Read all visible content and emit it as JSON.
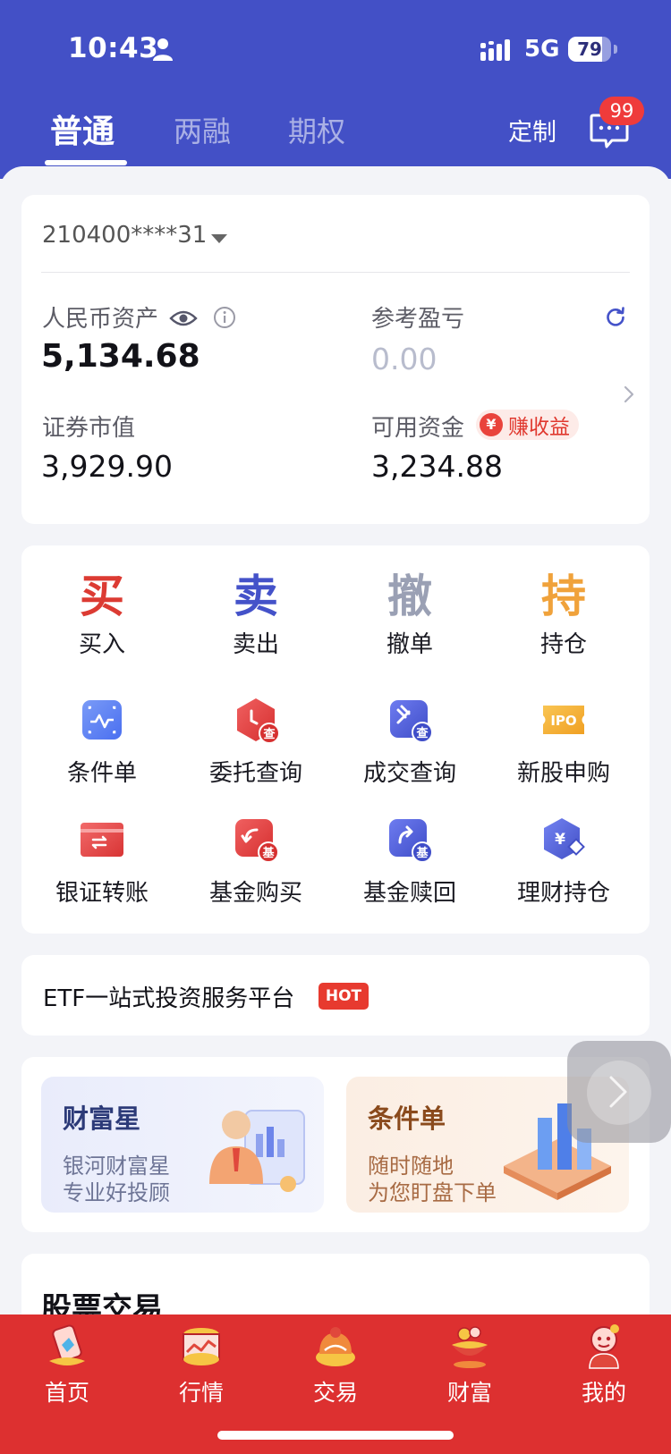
{
  "status_bar": {
    "time": "10:43",
    "network": "5G",
    "battery": "79",
    "battery_level": 0.79
  },
  "tabs": [
    {
      "label": "普通",
      "active": true
    },
    {
      "label": "两融",
      "active": false
    },
    {
      "label": "期权",
      "active": false
    }
  ],
  "header": {
    "customize_label": "定制",
    "message_badge": "99"
  },
  "account": {
    "number": "210400****31",
    "rmb_assets_label": "人民币资产",
    "rmb_assets_value": "5,134.68",
    "pnl_label": "参考盈亏",
    "pnl_value": "0.00",
    "market_value_label": "证券市值",
    "market_value": "3,929.90",
    "available_label": "可用资金",
    "available_value": "3,234.88",
    "earn_badge_icon": "¥",
    "earn_badge": "赚收益"
  },
  "quick_actions": [
    {
      "char": "买",
      "label": "买入",
      "color": "#dc3b33"
    },
    {
      "char": "卖",
      "label": "卖出",
      "color": "#4452c9"
    },
    {
      "char": "撤",
      "label": "撤单",
      "color": "#9aa0b4"
    },
    {
      "char": "持",
      "label": "持仓",
      "color": "#f0a23b"
    }
  ],
  "functions": [
    {
      "label": "条件单",
      "icon": "condition-order-icon"
    },
    {
      "label": "委托查询",
      "icon": "order-query-icon",
      "icon_badge": "查"
    },
    {
      "label": "成交查询",
      "icon": "deal-query-icon",
      "icon_badge": "查"
    },
    {
      "label": "新股申购",
      "icon": "ipo-icon",
      "icon_text": "IPO"
    },
    {
      "label": "银证转账",
      "icon": "bank-transfer-icon"
    },
    {
      "label": "基金购买",
      "icon": "fund-buy-icon",
      "icon_badge": "基"
    },
    {
      "label": "基金赎回",
      "icon": "fund-redeem-icon",
      "icon_badge": "基"
    },
    {
      "label": "理财持仓",
      "icon": "wealth-holding-icon",
      "icon_text": "¥"
    }
  ],
  "etf": {
    "label": "ETF一站式投资服务平台",
    "badge": "HOT"
  },
  "promos": [
    {
      "title": "财富星",
      "line1": "银河财富星",
      "line2": "专业好投顾"
    },
    {
      "title": "条件单",
      "line1": "随时随地",
      "line2": "为您盯盘下单"
    }
  ],
  "stock_section": {
    "title": "股票交易"
  },
  "bottom_nav": [
    {
      "label": "首页",
      "icon": "home-icon"
    },
    {
      "label": "行情",
      "icon": "market-icon"
    },
    {
      "label": "交易",
      "icon": "trade-icon"
    },
    {
      "label": "财富",
      "icon": "wealth-icon"
    },
    {
      "label": "我的",
      "icon": "profile-icon"
    }
  ]
}
